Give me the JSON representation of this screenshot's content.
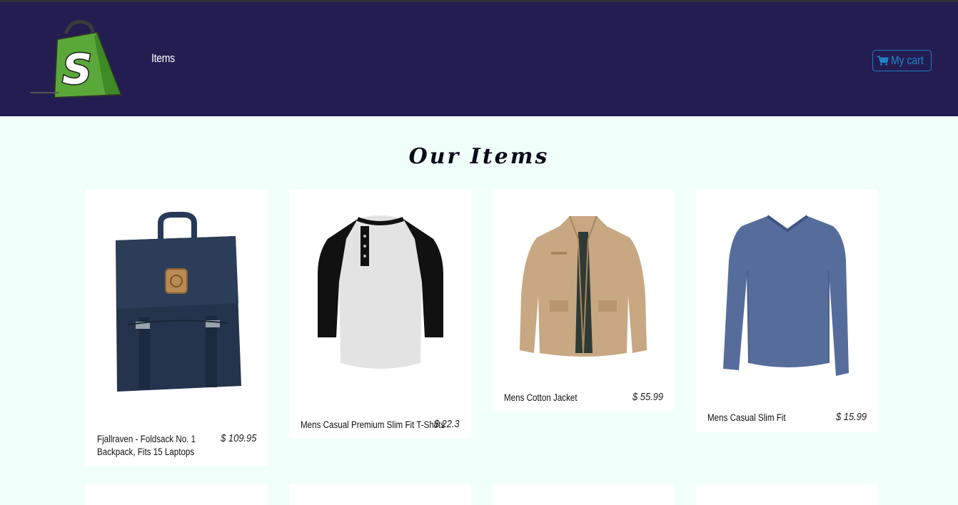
{
  "header": {
    "nav_items_label": "Items",
    "cart_label": "My cart",
    "brand_color": "#231d52",
    "accent_color": "#1f86c8"
  },
  "main": {
    "title": "Our Items",
    "products": [
      {
        "name": "Fjallraven - Foldsack No. 1 Backpack, Fits 15 Laptops",
        "price": "$ 109.95",
        "image": "backpack"
      },
      {
        "name": "Mens Casual Premium Slim Fit T-Shirts",
        "price": "$ 22.3",
        "image": "raglan-tshirt"
      },
      {
        "name": "Mens Cotton Jacket",
        "price": "$ 55.99",
        "image": "jacket"
      },
      {
        "name": "Mens Casual Slim Fit",
        "price": "$ 15.99",
        "image": "longsleeve-shirt"
      }
    ]
  }
}
